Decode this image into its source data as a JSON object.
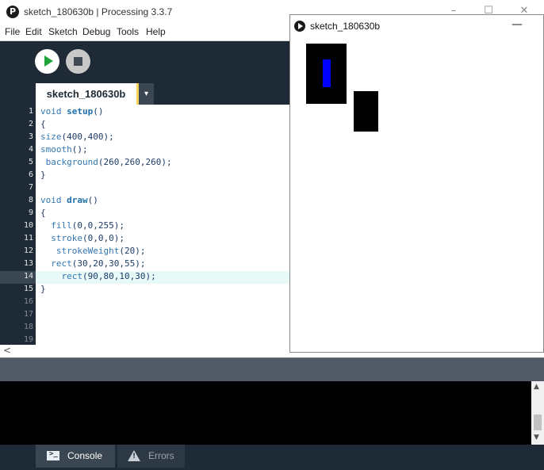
{
  "ide": {
    "window_title": "sketch_180630b | Processing 3.3.7",
    "logo_letter": "P",
    "window_controls": [
      "–",
      "☐",
      "✕"
    ],
    "menu": [
      "File",
      "Edit",
      "Sketch",
      "Debug",
      "Tools",
      "Help"
    ],
    "tab_label": "sketch_180630b",
    "tab_menu_glyph": "▾",
    "code_lines": [
      {
        "n": "1",
        "text": "void setup()"
      },
      {
        "n": "2",
        "text": "{"
      },
      {
        "n": "3",
        "text": "size(400,400);"
      },
      {
        "n": "4",
        "text": "smooth();"
      },
      {
        "n": "5",
        "text": " background(260,260,260);"
      },
      {
        "n": "6",
        "text": "}"
      },
      {
        "n": "7",
        "text": ""
      },
      {
        "n": "8",
        "text": "void draw()"
      },
      {
        "n": "9",
        "text": "{"
      },
      {
        "n": "10",
        "text": "  fill(0,0,255);"
      },
      {
        "n": "11",
        "text": "  stroke(0,0,0);"
      },
      {
        "n": "12",
        "text": "   strokeWeight(20);"
      },
      {
        "n": "13",
        "text": "  rect(30,20,30,55);"
      },
      {
        "n": "14",
        "text": "    rect(90,80,10,30);"
      },
      {
        "n": "15",
        "text": "}"
      },
      {
        "n": "16",
        "text": ""
      },
      {
        "n": "17",
        "text": ""
      },
      {
        "n": "18",
        "text": ""
      },
      {
        "n": "19",
        "text": ""
      }
    ],
    "current_line": "14",
    "footer": {
      "console_label": "Console",
      "errors_label": "Errors"
    },
    "colors": {
      "run_green": "#1fa33a",
      "tab_accent": "#f6d25b",
      "ide_dark": "#1e2a35"
    }
  },
  "sketch_window": {
    "title": "sketch_180630b",
    "minimize_glyph": "—",
    "fill_color": "#0000ff",
    "stroke_color": "#000000"
  }
}
